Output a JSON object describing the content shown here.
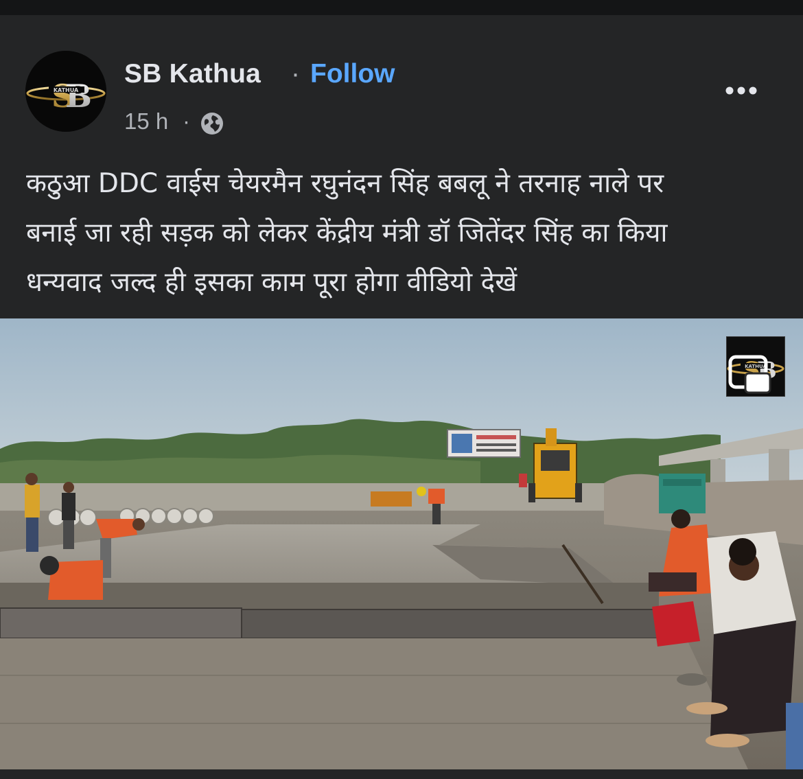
{
  "post": {
    "author": "SB Kathua",
    "separator": "·",
    "follow_label": "Follow",
    "time": "15 h",
    "time_separator": "·",
    "privacy_icon": "globe-icon",
    "more_icon": "more-horizontal-icon",
    "text_lines": [
      "कठुआ DDC वाईस चेयरमैन रघुनंदन सिंह बबलू ने तरनाह नाले पर",
      "बनाई जा रही सड़क को लेकर केंद्रीय मंत्री डॉ जितेंदर सिंह का किया",
      "धन्यवाद जल्द ही इसका काम पूरा होगा वीडियो देखें"
    ]
  },
  "avatar": {
    "logo_letters": "SB",
    "logo_subtext": "KATHUA"
  },
  "media": {
    "type": "video-thumbnail",
    "watermark_letters": "SB",
    "watermark_subtext": "KATHUA",
    "pip_icon": "picture-in-picture-icon"
  },
  "colors": {
    "card_bg": "#242526",
    "page_bg": "#111213",
    "link": "#5aa7ff",
    "text_primary": "#e4e6eb",
    "text_secondary": "#b0b3b8"
  }
}
